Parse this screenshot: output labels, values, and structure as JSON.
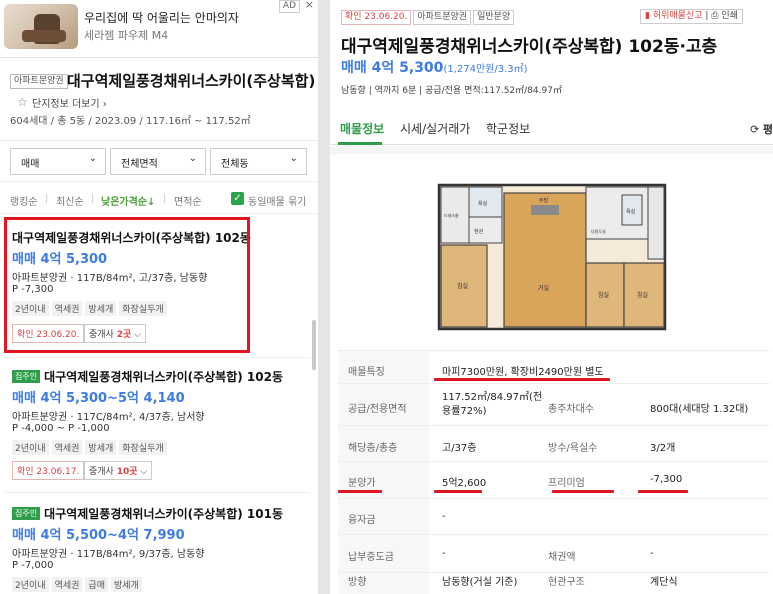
{
  "ad": {
    "title": "우리집에 딱 어울리는 안마의자",
    "subtitle": "세라젬 파우제 M4",
    "badge": "AD",
    "close": "×"
  },
  "complex": {
    "type_tag": "아파트분양권",
    "name": "대구역제일풍경채위너스카이(주상복합)",
    "more_link": "단지정보 더보기",
    "meta": "604세대 / 총 5동 / 2023.09 / 117.16㎡ ~ 117.52㎡"
  },
  "filters": {
    "trade": "매매",
    "area": "전체면적",
    "building": "전체동"
  },
  "sort": {
    "ranking": "랭킹순",
    "latest": "최신순",
    "low_price": "낮은가격순↓",
    "area": "면적순",
    "group_same": "동일매물 묶기"
  },
  "listings": [
    {
      "owner_tag": "",
      "title": "대구역제일풍경채위너스카이(주상복합) 102동",
      "price": "매매 4억 5,300",
      "spec": "아파트분양권 · 117B/84m², 고/37층, 남동향",
      "premium": "P -7,300",
      "tags": [
        "2년이내",
        "역세권",
        "방세개",
        "화장실두개"
      ],
      "confirm": "확인 23.06.20.",
      "agents_prefix": "중개사 ",
      "agents_count": "2곳",
      "agents_suffix": " ⌵"
    },
    {
      "owner_tag": "집주인",
      "title": "대구역제일풍경채위너스카이(주상복합) 102동",
      "price": "매매 4억 5,300~5억 4,140",
      "spec": "아파트분양권 · 117C/84m², 4/37층, 남서향",
      "premium": "P -4,000 ~ P -1,000",
      "tags": [
        "2년이내",
        "역세권",
        "방세개",
        "화장실두개"
      ],
      "confirm": "확인 23.06.17.",
      "agents_prefix": "중개사 ",
      "agents_count": "10곳",
      "agents_suffix": " ⌵"
    },
    {
      "owner_tag": "집주인",
      "title": "대구역제일풍경채위너스카이(주상복합) 101동",
      "price": "매매 4억 5,500~4억 7,990",
      "spec": "아파트분양권 · 117B/84m², 9/37층, 남동향",
      "premium": "P -7,000",
      "tags": [
        "2년이내",
        "역세권",
        "급매",
        "방세개"
      ]
    }
  ],
  "detail": {
    "top_tags": [
      "확인 23.06.20.",
      "아파트분양권",
      "일반분양"
    ],
    "report": "허위매물신고",
    "print": "인쇄",
    "title": "대구역제일풍경채위너스카이(주상복합) 102동·고층",
    "price": "매매 4억 5,300",
    "price_per": "(1,274만원/3.3㎡)",
    "meta": "남동향 | 역까지 6분 | 공급/전용 면적:117.52㎡/84.97㎡",
    "tabs": [
      "매물정보",
      "시세/실거래가",
      "학군정보"
    ],
    "share": "평",
    "floorplan_labels": {
      "living": "거실",
      "room": "침실",
      "kitchen": "주방",
      "bath": "욕실",
      "dress": "드레스룸",
      "util": "다용도실",
      "porch": "현관",
      "balcony": "발코니"
    },
    "info": [
      {
        "k": "매물특징",
        "v": "마피7300만원, 확장비2490만원 별도"
      },
      {
        "k": "공급/전용면적",
        "v": "117.52㎡/84.97㎡(전용률72%)",
        "k2": "총주차대수",
        "v2": "800대(세대당 1.32대)"
      },
      {
        "k": "해당층/총층",
        "v": "고/37층",
        "k2": "방수/욕실수",
        "v2": "3/2개"
      },
      {
        "k": "분양가",
        "v": "5억2,600",
        "k2": "프리미엄",
        "v2": "-7,300"
      },
      {
        "k": "융자금",
        "v": "-"
      },
      {
        "k": "납부중도금",
        "v": "-",
        "k2": "채권액",
        "v2": "-"
      },
      {
        "k": "방향",
        "v": "남동향(거실 기준)",
        "k2": "현관구조",
        "v2": "계단식"
      }
    ]
  },
  "colors": {
    "price_blue": "#3c7be8",
    "accent_green": "#2e9e4a",
    "highlight_red": "#e0151f"
  }
}
